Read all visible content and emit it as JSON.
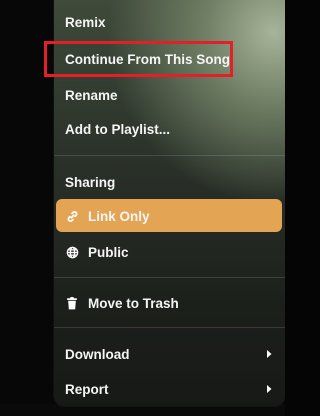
{
  "menu": {
    "remix": "Remix",
    "continue": "Continue From This Song",
    "rename": "Rename",
    "add_to_playlist": "Add to Playlist...",
    "sharing": "Sharing",
    "link_only": "Link Only",
    "public": "Public",
    "move_to_trash": "Move to Trash",
    "download": "Download",
    "report": "Report"
  },
  "colors": {
    "highlight_outline": "#e32028",
    "selected_background": "#e3a454"
  },
  "icons": {
    "link_only": "link-icon",
    "public": "globe-icon",
    "move_to_trash": "trash-icon",
    "download": "chevron-right-icon",
    "report": "chevron-right-icon"
  }
}
